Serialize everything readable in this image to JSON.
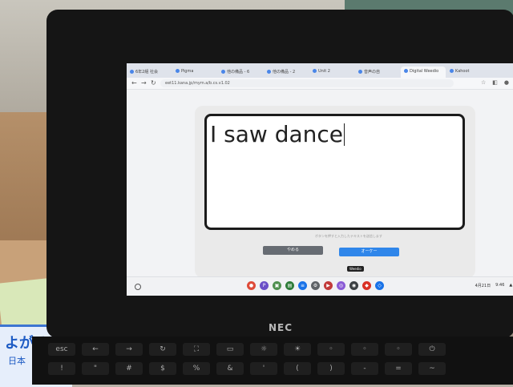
{
  "browser": {
    "tabs": [
      "6年2組 社会",
      "Pigma",
      "他の備品 - 6",
      "他の備品 - 2",
      "Unit 2",
      "音声の自",
      "Digital Weedio",
      "Kahoot"
    ],
    "active_tab_index": 6,
    "url": "eet11.kana.jp/mym.a/b.cs.v1.02"
  },
  "dialog": {
    "typed_text": "I saw dance",
    "hint": "ボタンを押すと入力したテキストを送信します",
    "cancel_label": "やめる",
    "ok_label": "オーケー"
  },
  "shelf": {
    "tooltip": "Weedio",
    "status_time": "9:46",
    "status_date": "4月21日"
  },
  "device": {
    "brand": "NEC"
  },
  "poster": {
    "text": "よがる",
    "subtext": "日本"
  }
}
